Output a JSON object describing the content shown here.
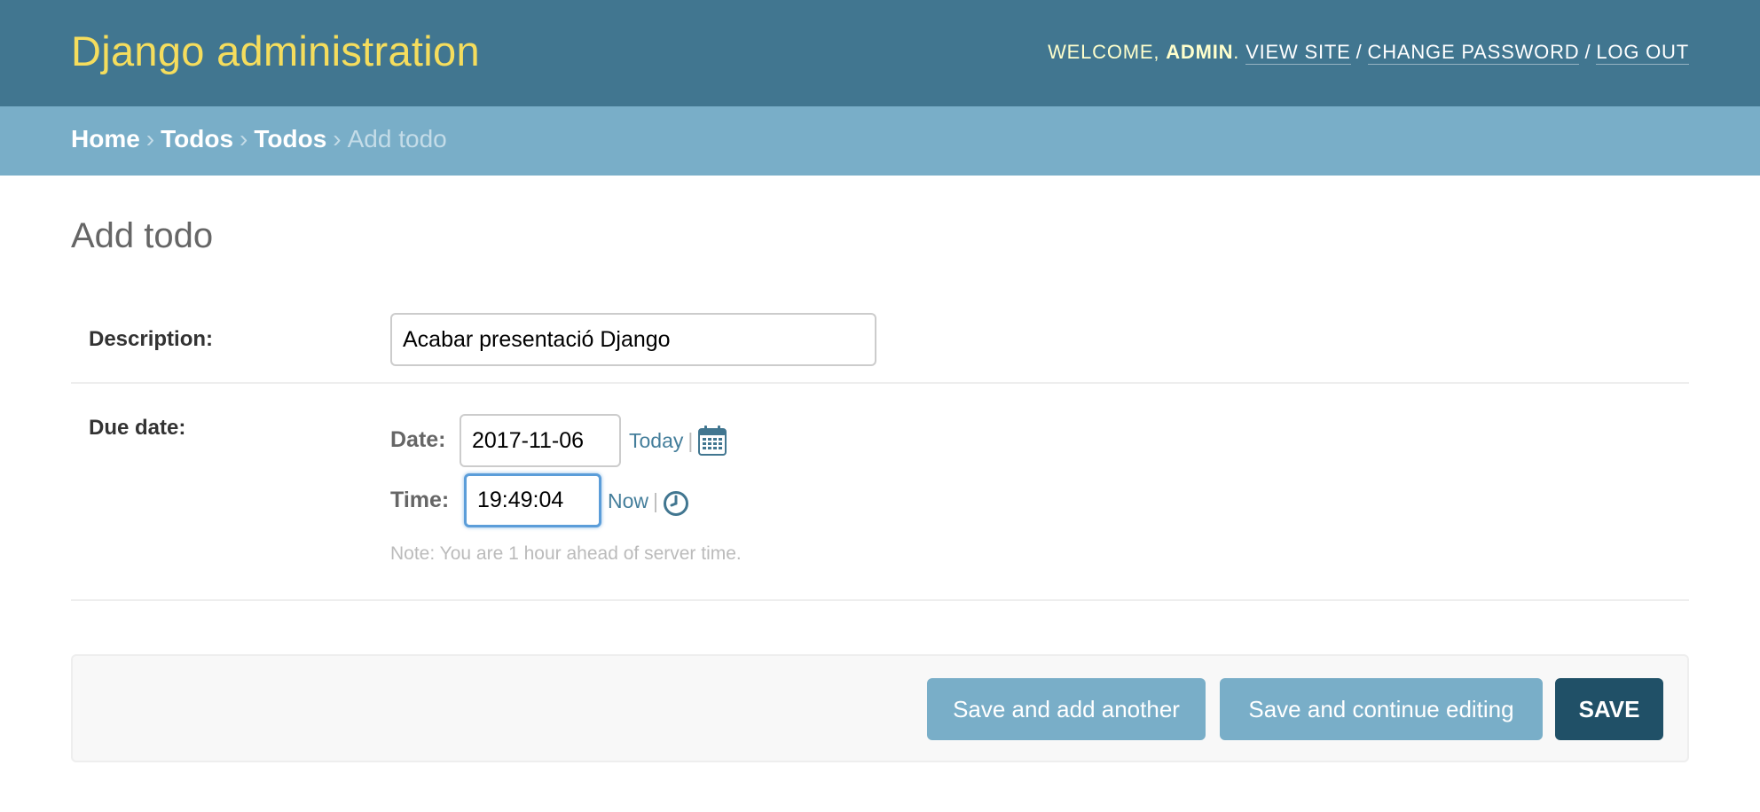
{
  "header": {
    "brand": "Django administration",
    "welcome": "WELCOME, ",
    "username": "ADMIN",
    "period": ".",
    "view_site": "VIEW SITE",
    "change_password": "CHANGE PASSWORD",
    "log_out": "LOG OUT",
    "separator": "/"
  },
  "breadcrumbs": {
    "arrow": "›",
    "items": [
      "Home",
      "Todos",
      "Todos"
    ],
    "current": "Add todo"
  },
  "page": {
    "title": "Add todo"
  },
  "form": {
    "description": {
      "label": "Description:",
      "value": "Acabar presentació Django"
    },
    "due_date": {
      "label": "Due date:",
      "date_label": "Date:",
      "date_value": "2017-11-06",
      "today_link": "Today",
      "time_label": "Time:",
      "time_value": "19:49:04",
      "now_link": "Now",
      "bar": "|",
      "note": "Note: You are 1 hour ahead of server time.",
      "calendar_icon": "calendar-icon",
      "clock_icon": "clock-icon"
    }
  },
  "submit": {
    "save_add_another": "Save and add another",
    "save_continue": "Save and continue editing",
    "save": "SAVE"
  },
  "colors": {
    "header_bg": "#417690",
    "brand": "#f5dd5d",
    "breadcrumb_bg": "#79aec8",
    "link": "#447e9b",
    "button_light": "#79aec8",
    "button_dark": "#205067"
  }
}
